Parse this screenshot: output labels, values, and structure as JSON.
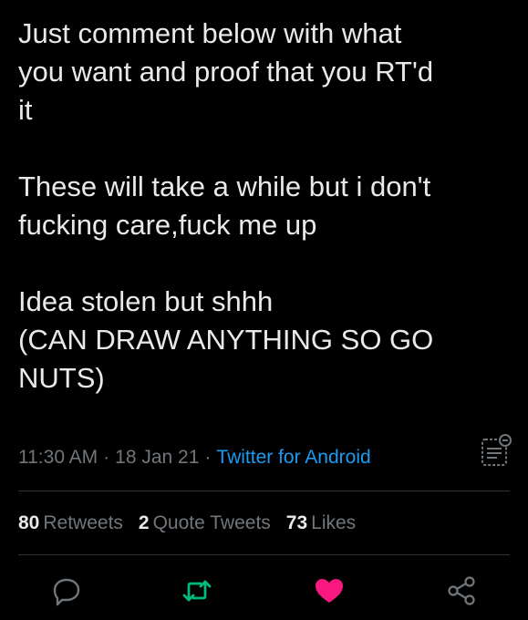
{
  "tweet": {
    "lines": [
      "Just comment below with what",
      "you want and proof that you RT'd",
      "it",
      "These will take a while but i don't",
      "fucking care,fuck me up",
      "Idea stolen but shhh",
      "(CAN DRAW ANYTHING SO GO",
      "NUTS)"
    ]
  },
  "meta": {
    "time": "11:30 AM",
    "separator": "·",
    "date": "18 Jan 21",
    "source": "Twitter for Android"
  },
  "stats": {
    "retweets_count": "80",
    "retweets_label": "Retweets",
    "quote_count": "2",
    "quote_label": "Quote Tweets",
    "likes_count": "73",
    "likes_label": "Likes"
  },
  "icons": {
    "analytics": "analytics-icon",
    "reply": "reply-icon",
    "retweet": "retweet-icon",
    "like": "heart-icon",
    "share": "share-icon"
  },
  "colors": {
    "background": "#000000",
    "text": "#e7e9ea",
    "muted": "#71767b",
    "link": "#1d9bf0",
    "retweet_active": "#00ba7c",
    "like_active": "#f91880",
    "divider": "#2f3336"
  }
}
